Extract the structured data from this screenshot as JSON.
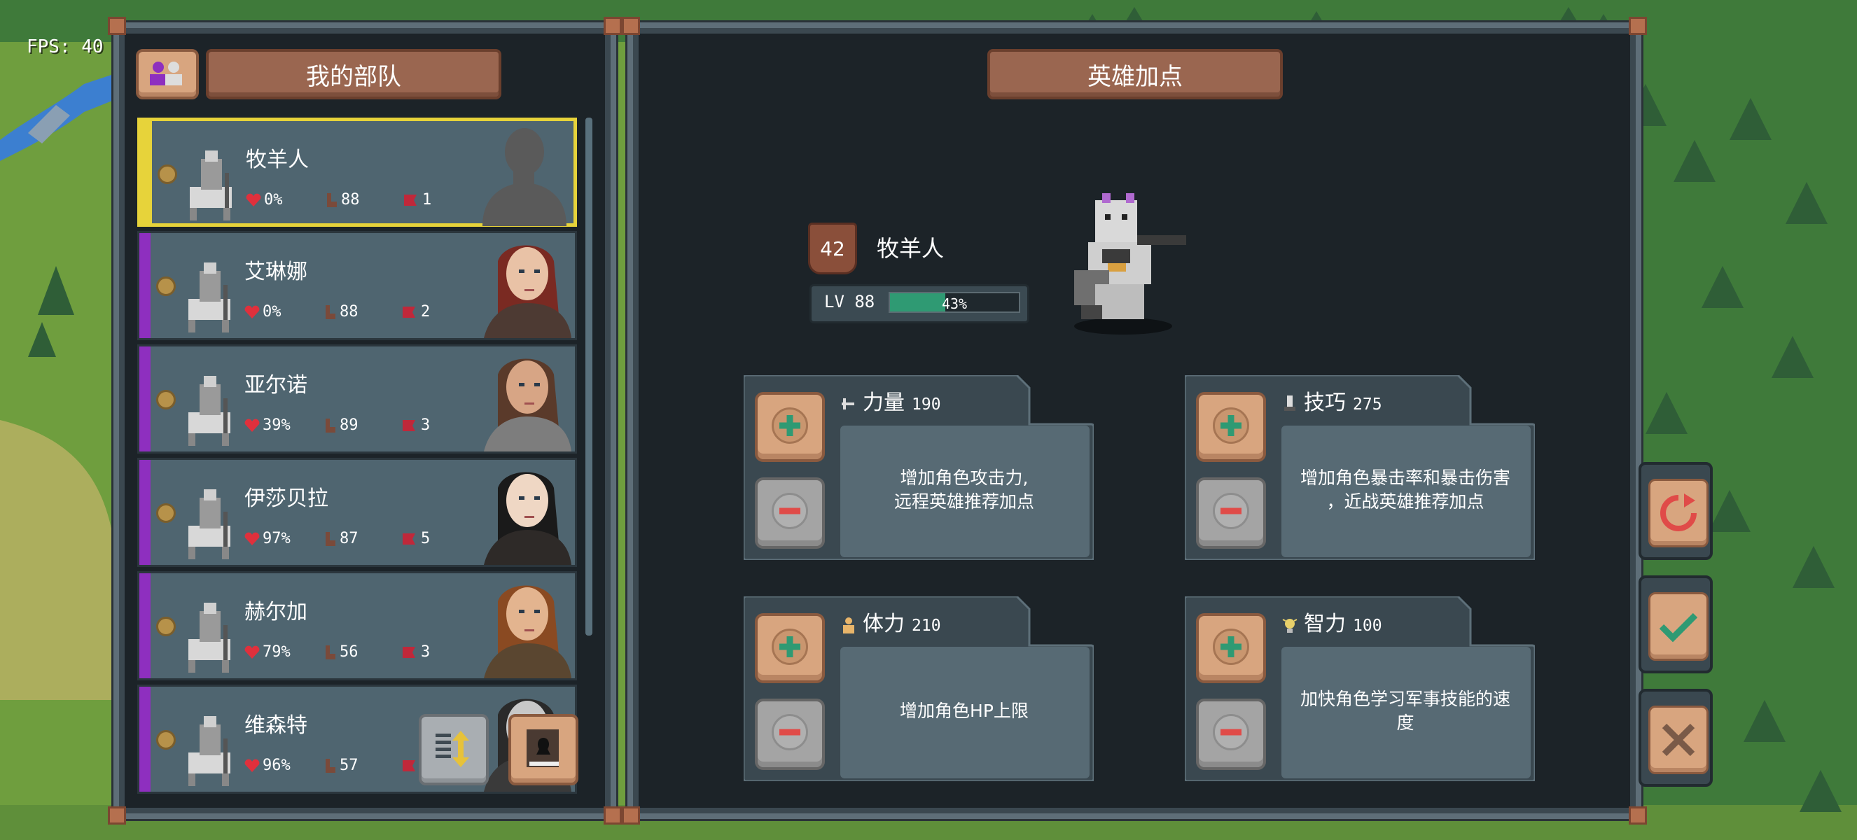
{
  "hud": {
    "fps": "FPS: 40"
  },
  "left_panel": {
    "title": "我的部队",
    "heroes": [
      {
        "name": "牧羊人",
        "hp": "0%",
        "level": "88",
        "count": "1",
        "selected": true
      },
      {
        "name": "艾琳娜",
        "hp": "0%",
        "level": "88",
        "count": "2",
        "selected": false
      },
      {
        "name": "亚尔诺",
        "hp": "39%",
        "level": "89",
        "count": "3",
        "selected": false
      },
      {
        "name": "伊莎贝拉",
        "hp": "97%",
        "level": "87",
        "count": "5",
        "selected": false
      },
      {
        "name": "赫尔加",
        "hp": "79%",
        "level": "56",
        "count": "3",
        "selected": false
      },
      {
        "name": "维森特",
        "hp": "96%",
        "level": "57",
        "count": "",
        "selected": false
      }
    ]
  },
  "right_panel": {
    "title": "英雄加点",
    "hero": {
      "rank": "42",
      "name": "牧羊人",
      "level_label": "LV 88",
      "xp_percent": "43%",
      "xp_fraction": 0.43
    },
    "attributes": [
      {
        "name": "力量",
        "value": "190",
        "desc_line1": "增加角色攻击力,",
        "desc_line2": "远程英雄推荐加点",
        "icon": "sword-icon"
      },
      {
        "name": "技巧",
        "value": "275",
        "desc_line1": "增加角色暴击率和暴击伤害",
        "desc_line2": "，近战英雄推荐加点",
        "icon": "dagger-icon"
      },
      {
        "name": "体力",
        "value": "210",
        "desc_line1": "增加角色HP上限",
        "desc_line2": "",
        "icon": "person-icon"
      },
      {
        "name": "智力",
        "value": "100",
        "desc_line1": "加快角色学习军事技能的速",
        "desc_line2": "度",
        "icon": "bulb-icon"
      }
    ]
  },
  "side_buttons": [
    "reset-icon",
    "confirm-icon",
    "close-icon"
  ],
  "colors": {
    "accent_tan": "#d8a57f",
    "plate_brown": "#9a6650",
    "select_yellow": "#e7d33a",
    "hero_purple": "#8e2fbf",
    "xp_green": "#2f9a73"
  }
}
